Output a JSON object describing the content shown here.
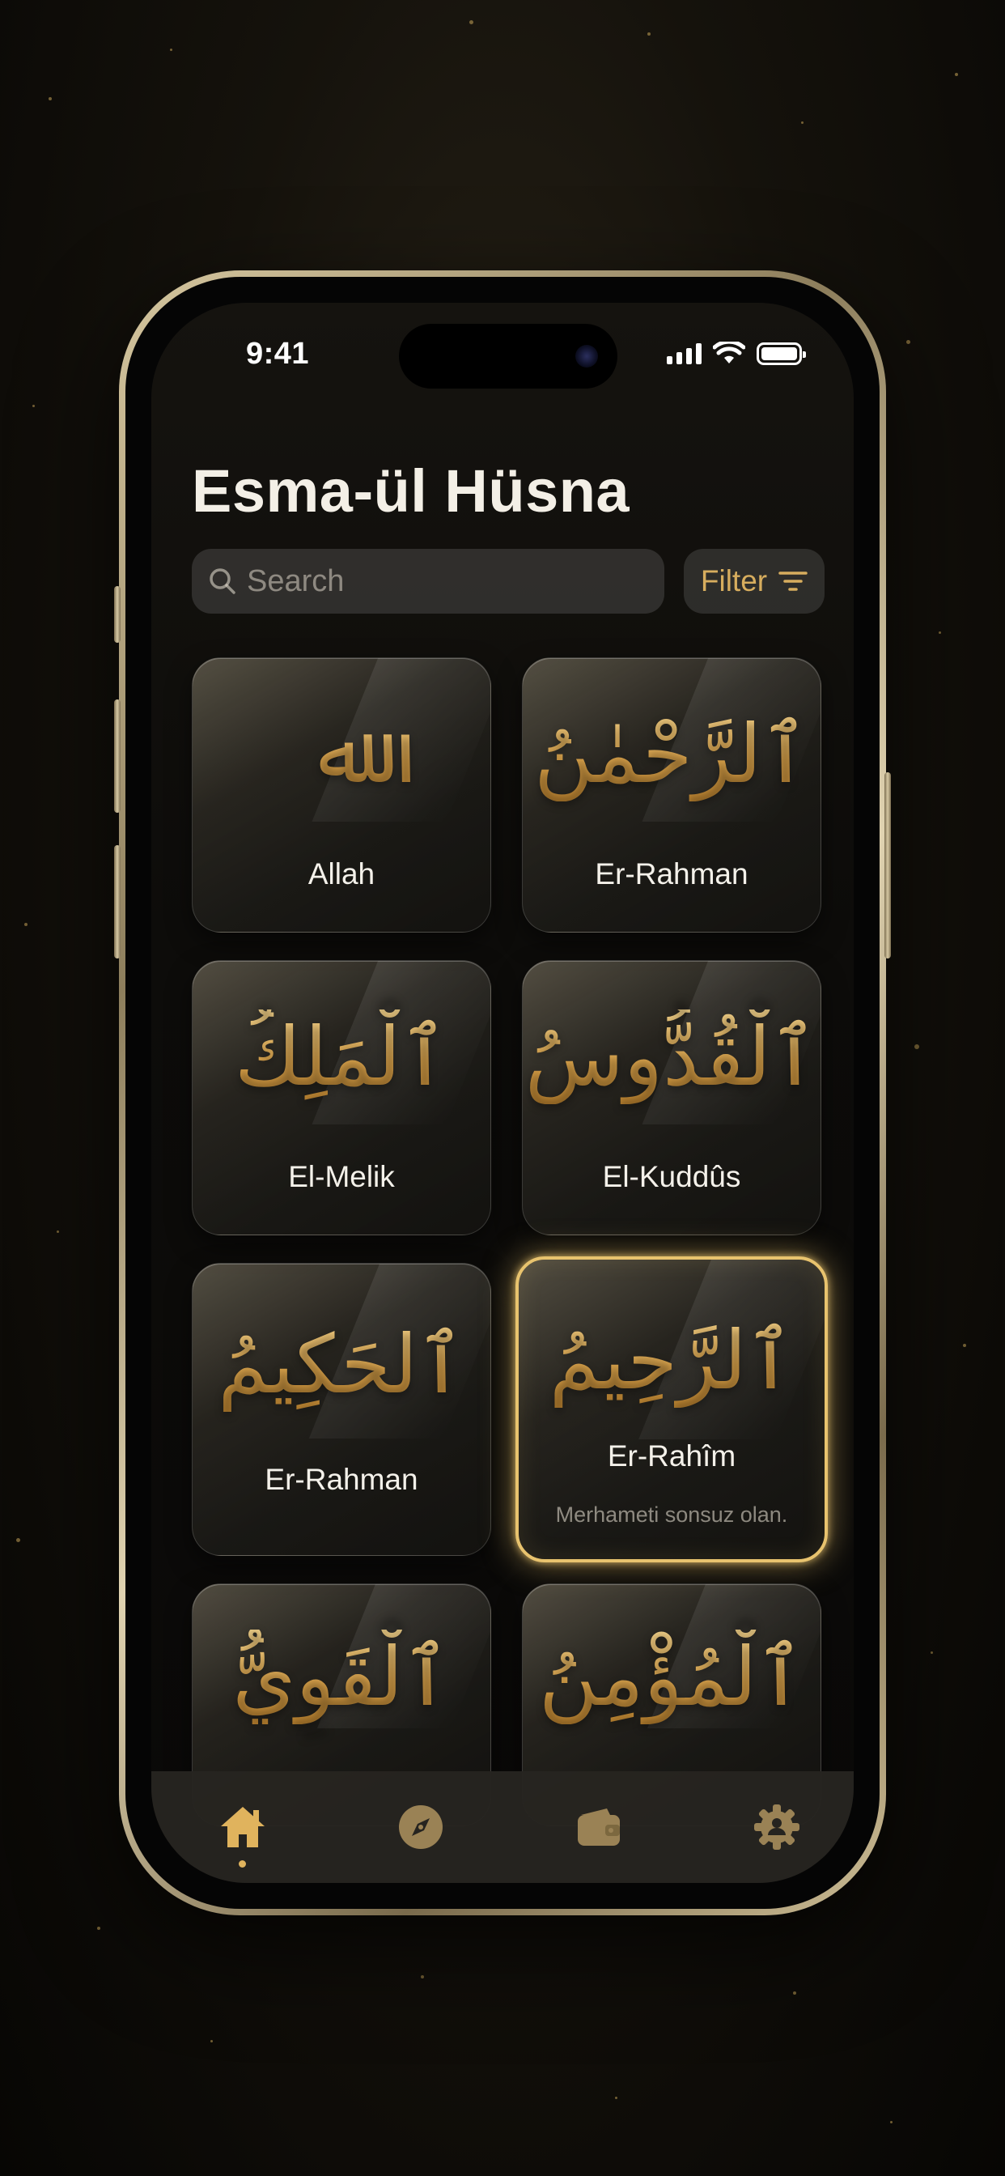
{
  "status_bar": {
    "time": "9:41"
  },
  "header": {
    "title": "Esma-ül Hüsna"
  },
  "search": {
    "placeholder": "Search"
  },
  "filter": {
    "label": "Filter"
  },
  "names": [
    {
      "arabic": "ﷲ",
      "latin": "Allah"
    },
    {
      "arabic": "ٱلرَّحْمٰنُ",
      "latin": "Er-Rahman"
    },
    {
      "arabic": "ٱلْمَلِكُ",
      "latin": "El-Melik"
    },
    {
      "arabic": "ٱلْقُدُّوسُ",
      "latin": "El-Kuddûs"
    },
    {
      "arabic": "ٱلحَكِيمُ",
      "latin": "Er-Rahman"
    },
    {
      "arabic": "ٱلرَّحِيمُ",
      "latin": "Er-Rahîm",
      "description": "Merhameti sonsuz olan.",
      "selected": true
    },
    {
      "arabic": "ٱلْقَوِيُّ",
      "latin": ""
    },
    {
      "arabic": "ٱلْمُؤْمِنُ",
      "latin": ""
    }
  ],
  "tab_bar": {
    "items": [
      {
        "icon": "home-icon",
        "active": true
      },
      {
        "icon": "compass-icon",
        "active": false
      },
      {
        "icon": "wallet-icon",
        "active": false
      },
      {
        "icon": "settings-icon",
        "active": false
      }
    ]
  },
  "colors": {
    "accent_gold": "#e0b35d",
    "inactive_icon": "#9a8255"
  }
}
